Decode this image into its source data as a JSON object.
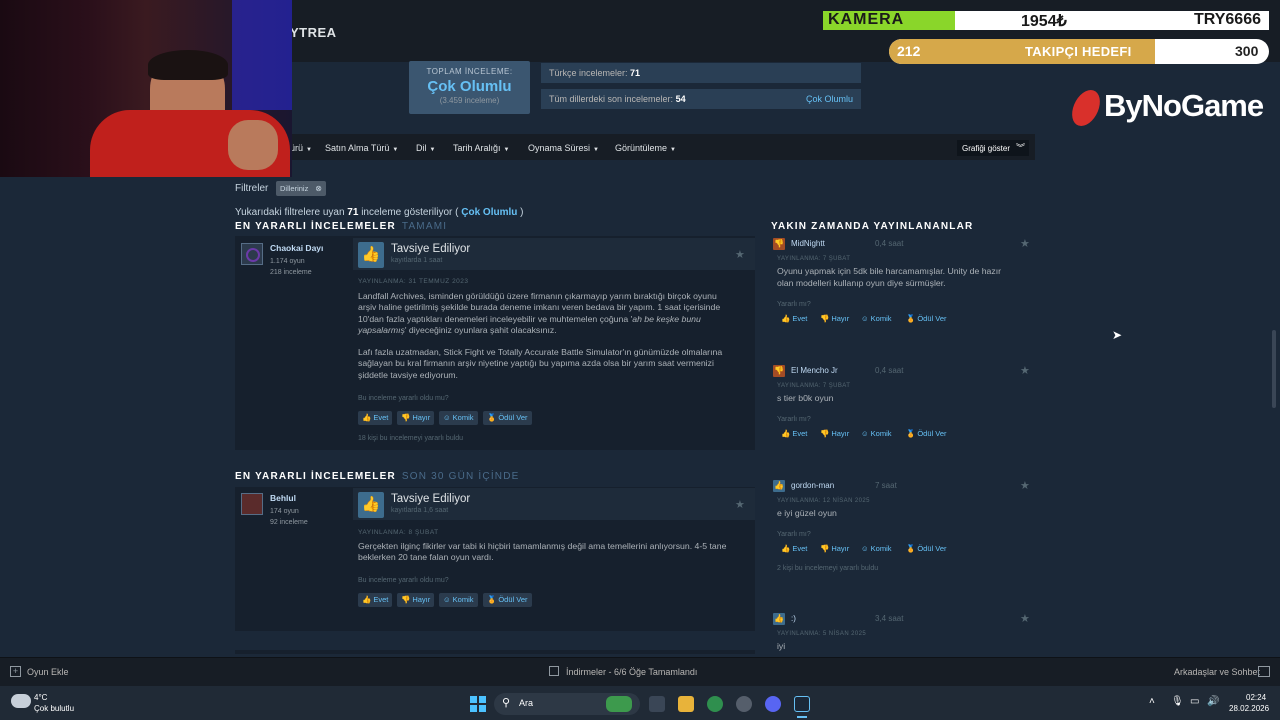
{
  "game_title": "YTREA",
  "summary": {
    "label": "TOPLAM İNCELEME:",
    "rating": "Çok Olumlu",
    "count": "(3.459 inceleme)",
    "turkish_label": "Türkçe incelemeler:",
    "turkish_count": "71",
    "recent_label": "Tüm dillerdeki son incelemeler:",
    "recent_count": "54",
    "recent_rating": "Çok Olumlu"
  },
  "filters": {
    "items": [
      "ürü",
      "Satın Alma Türü",
      "Dil",
      "Tarih Aralığı",
      "Oynama Süresi",
      "Görüntüleme"
    ],
    "graph_button": "Grafiği göster",
    "filters_label": "Filtreler",
    "chip": "Dilleriniz",
    "showing_prefix": "Yukarıdaki filtrelere uyan",
    "showing_count": "71",
    "showing_mid": "inceleme gösteriliyor (",
    "showing_rating": "Çok Olumlu",
    "showing_end": ")"
  },
  "section1": {
    "title": "EN YARARLI İNCELEMELER",
    "sub": "TAMAMI"
  },
  "section2": {
    "title": "EN YARARLI İNCELEMELER",
    "sub": "SON 30 GÜN İÇİNDE"
  },
  "recent_section": "YAKIN ZAMANDA YAYINLANANLAR",
  "reviews": [
    {
      "name": "Chaokai Dayı",
      "games": "1.174 oyun",
      "reviews": "218 inceleme",
      "verdict": "Tavsiye Ediliyor",
      "hours": "kayıtlarda 1 saat",
      "posted": "YAYINLANMA: 31 TEMMUZ 2023",
      "p1a": "Landfall Archives, isminden görüldüğü üzere firmanın çıkarmayıp yarım bıraktığı birçok oyunu",
      "p1b": "arşiv haline getirilmiş şekilde burada deneme imkanı veren bedava bir yapım. 1 saat içerisinde",
      "p1c": "10'dan fazla yaptıkları denemeleri inceleyebilir ve muhtemelen çoğuna '",
      "p1c_i": "ah be keşke bunu",
      "p1d_i": "yapsalarmış",
      "p1d": "' diyeceğiniz oyunlara şahit olacaksınız.",
      "p2a": "Lafı fazla uzatmadan, Stick Fight ve Totally Accurate Battle Simulator'ın günümüzde olmalarına",
      "p2b": "sağlayan bu kral firmanın arşiv niyetine yaptığı bu yapıma azda olsa bir yarım saat vermenizi",
      "p2c": "şiddetle tavsiye ediyorum.",
      "question": "Bu inceleme yararlı oldu mu?",
      "found": "18 kişi bu incelemeyi yararlı buldu"
    },
    {
      "name": "Behlul",
      "games": "174 oyun",
      "reviews": "92 inceleme",
      "verdict": "Tavsiye Ediliyor",
      "hours": "kayıtlarda 1,6 saat",
      "posted": "YAYINLANMA: 8 ŞUBAT",
      "p1a": "Gerçekten ilginç fikirler var tabi ki hiçbiri tamamlanmış değil ama temellerini anlıyorsun. 4-5 tane",
      "p1b": "beklerken 20 tane falan oyun vardı.",
      "question": "Bu inceleme yararlı oldu mu?"
    }
  ],
  "vote": {
    "yes": "Evet",
    "no": "Hayır",
    "funny": "Komik",
    "award": "Ödül Ver"
  },
  "recent": [
    {
      "name": "MidNightt",
      "hours": "0,4 saat",
      "posted": "YAYINLANMA: 7 ŞUBAT",
      "text1": "Oyunu yapmak için 5dk bile harcamamışlar. Unity de hazır",
      "text2": "olan modelleri kullanıp oyun diye sürmüşler.",
      "q": "Yararlı mı?"
    },
    {
      "name": "El Mencho Jr",
      "hours": "0,4 saat",
      "posted": "YAYINLANMA: 7 ŞUBAT",
      "text1": "s tier b0k oyun",
      "q": "Yararlı mı?"
    },
    {
      "name": "gordon-man",
      "hours": "7 saat",
      "posted": "YAYINLANMA: 12 NİSAN 2025",
      "text1": "e iyi güzel oyun",
      "q": "Yararlı mı?",
      "found": "2 kişi bu incelemeyi yararlı buldu"
    },
    {
      "name": ":)",
      "hours": "3,4 saat",
      "posted": "YAYINLANMA: 5 NİSAN 2025",
      "text1": "iyi"
    }
  ],
  "bottom": {
    "add_game": "Oyun Ekle",
    "downloads": "İndirmeler - 6/6 Öğe Tamamlandı",
    "friends": "Arkadaşlar ve Sohbet"
  },
  "taskbar": {
    "temp": "4°C",
    "weather": "Çok bulutlu",
    "search": "Ara",
    "time": "02:24",
    "date": "28.02.2026"
  },
  "overlay": {
    "camera": "KAMERA",
    "amount": "1954₺",
    "code": "TRY6666",
    "follow_current": "212",
    "follow_label": "TAKIPÇI HEDEFI",
    "follow_target": "300",
    "follow_progress": 0.7,
    "brand": "ByNoGame"
  }
}
